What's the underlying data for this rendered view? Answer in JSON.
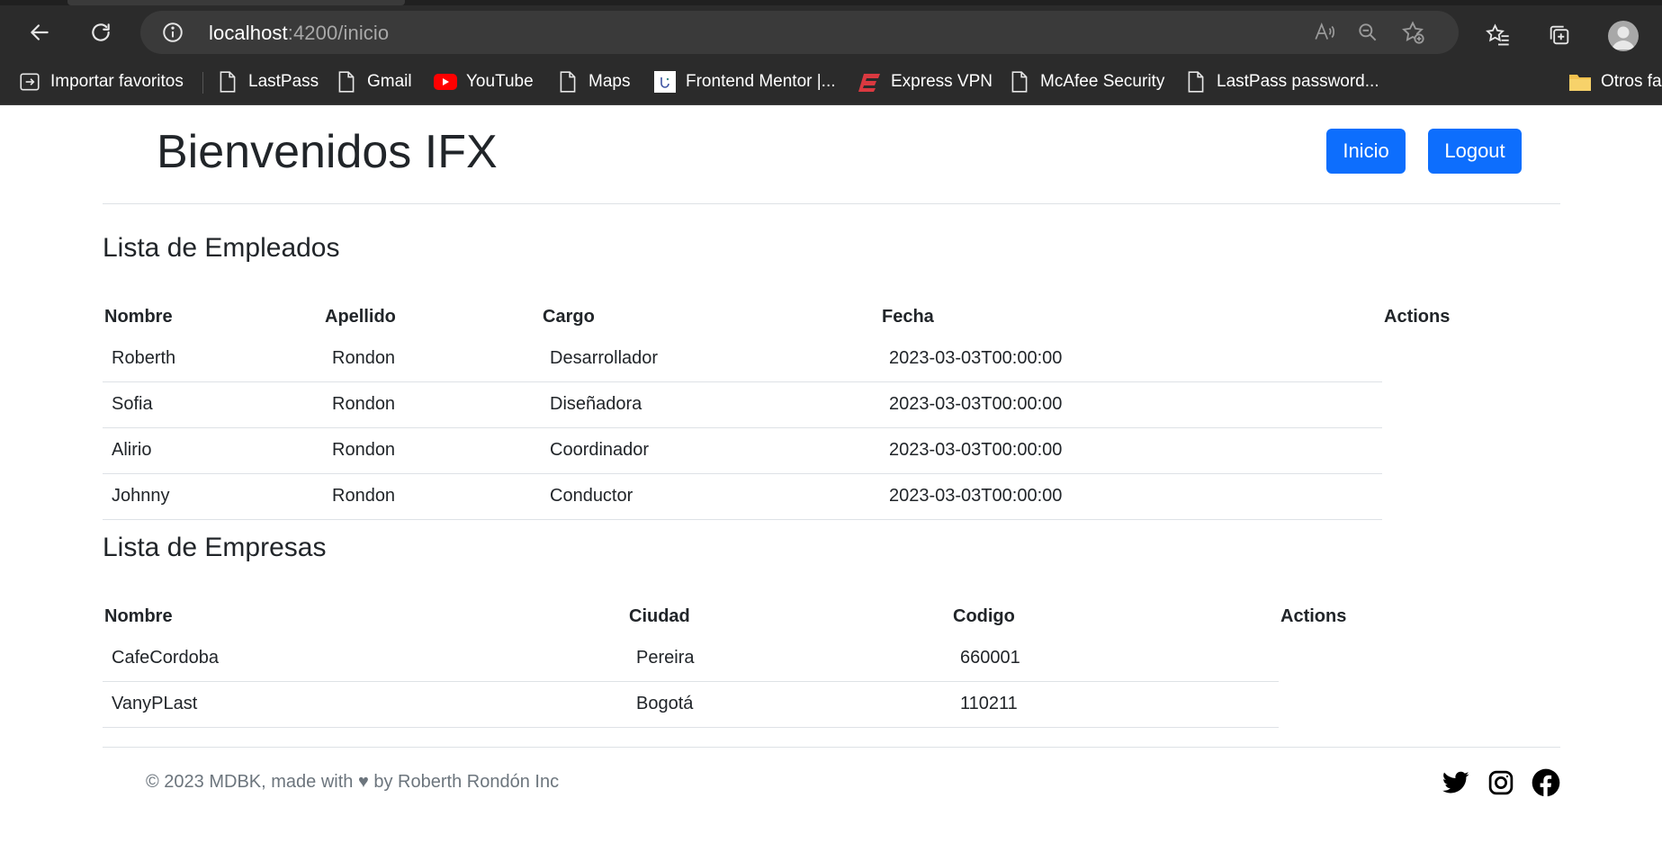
{
  "browser": {
    "url_host": "localhost",
    "url_path": ":4200/inicio",
    "bookmarks": [
      {
        "label": "Importar favoritos",
        "icon": "import-favorites-icon"
      },
      {
        "label": "LastPass",
        "icon": "page-icon"
      },
      {
        "label": "Gmail",
        "icon": "page-icon"
      },
      {
        "label": "YouTube",
        "icon": "youtube-icon"
      },
      {
        "label": "Maps",
        "icon": "page-icon"
      },
      {
        "label": "Frontend Mentor |...",
        "icon": "frontend-mentor-icon"
      },
      {
        "label": "Express VPN",
        "icon": "expressvpn-icon"
      },
      {
        "label": "McAfee Security",
        "icon": "page-icon"
      },
      {
        "label": "LastPass password...",
        "icon": "page-icon"
      },
      {
        "label": "Otros fa",
        "icon": "folder-icon"
      }
    ]
  },
  "header": {
    "title": "Bienvenidos IFX",
    "buttons": {
      "inicio": "Inicio",
      "logout": "Logout"
    }
  },
  "empleados": {
    "title": "Lista de Empleados",
    "columns": [
      "Nombre",
      "Apellido",
      "Cargo",
      "Fecha",
      "Actions"
    ],
    "rows": [
      [
        "Roberth",
        "Rondon",
        "Desarrollador",
        "2023-03-03T00:00:00"
      ],
      [
        "Sofia",
        "Rondon",
        "Diseñadora",
        "2023-03-03T00:00:00"
      ],
      [
        "Alirio",
        "Rondon",
        "Coordinador",
        "2023-03-03T00:00:00"
      ],
      [
        "Johnny",
        "Rondon",
        "Conductor",
        "2023-03-03T00:00:00"
      ]
    ]
  },
  "empresas": {
    "title": "Lista de Empresas",
    "columns": [
      "Nombre",
      "Ciudad",
      "Codigo",
      "Actions"
    ],
    "rows": [
      [
        "CafeCordoba",
        "Pereira",
        "660001"
      ],
      [
        "VanyPLast",
        "Bogotá",
        "110211"
      ]
    ]
  },
  "footer": {
    "copyright": "© 2023 MDBK, made with ♥ by Roberth Rondón Inc",
    "social": [
      "twitter-icon",
      "instagram-icon",
      "facebook-icon"
    ]
  },
  "colors": {
    "primary": "#0d6efd",
    "chrome_bg": "#2b2b2b",
    "text": "#212529",
    "muted": "#6c757d",
    "border": "#dee2e6"
  }
}
